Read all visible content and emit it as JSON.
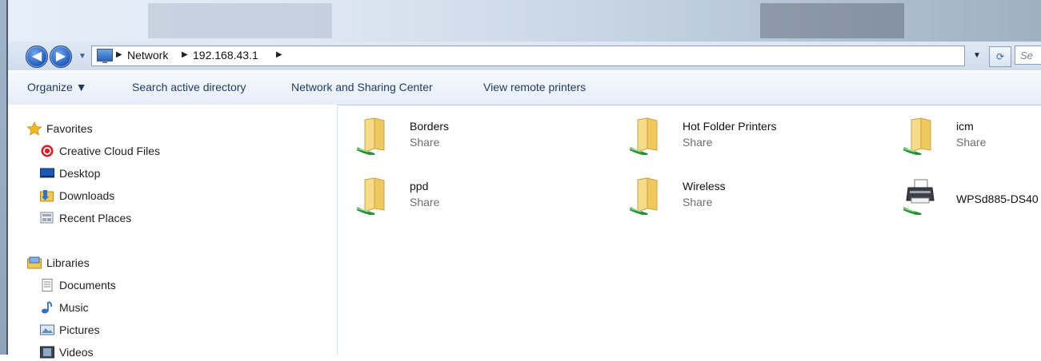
{
  "window": {
    "frame_color": "#9fb3c9"
  },
  "address": {
    "crumbs": [
      "Network",
      "192.168.43.1"
    ],
    "search_placeholder": "Se"
  },
  "toolbar": {
    "organize": "Organize ▼",
    "search_ad": "Search active directory",
    "network_center": "Network and Sharing Center",
    "remote_printers": "View remote printers"
  },
  "nav": {
    "favorites": {
      "label": "Favorites",
      "items": [
        "Creative Cloud Files",
        "Desktop",
        "Downloads",
        "Recent Places"
      ]
    },
    "libraries": {
      "label": "Libraries",
      "items": [
        "Documents",
        "Music",
        "Pictures",
        "Videos"
      ]
    }
  },
  "content": {
    "items": [
      {
        "name": "Borders",
        "type": "Share",
        "icon": "shared-folder-icon"
      },
      {
        "name": "Hot Folder Printers",
        "type": "Share",
        "icon": "shared-folder-icon"
      },
      {
        "name": "icm",
        "type": "Share",
        "icon": "shared-folder-icon"
      },
      {
        "name": "ppd",
        "type": "Share",
        "icon": "shared-folder-icon"
      },
      {
        "name": "Wireless",
        "type": "Share",
        "icon": "shared-folder-icon"
      },
      {
        "name": "WPSd885-DS40",
        "type": "",
        "icon": "network-printer-icon"
      }
    ]
  }
}
